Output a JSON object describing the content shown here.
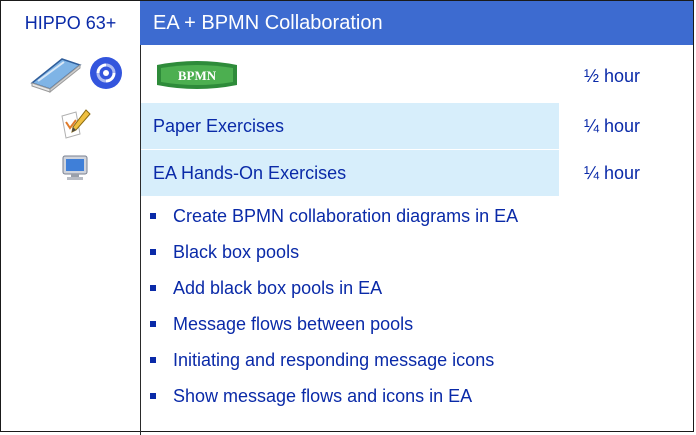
{
  "header": {
    "course_code": "HIPPO 63+",
    "title": "EA + BPMN Collaboration"
  },
  "schedule": [
    {
      "icons": [
        "book-icon",
        "cycle-icon"
      ],
      "label": "",
      "logo": "BPMN",
      "duration": "½ hour"
    },
    {
      "icons": [
        "pencil-paper-icon"
      ],
      "label": "Paper Exercises",
      "duration": "¼ hour"
    },
    {
      "icons": [
        "computer-monitor-icon"
      ],
      "label": "EA Hands-On Exercises",
      "duration": "¼ hour"
    }
  ],
  "topics": [
    "Create BPMN collaboration diagrams in EA",
    "Black box pools",
    "Add black box pools in EA",
    "Message flows between pools",
    "Initiating and responding message icons",
    "Show message flows and icons in EA"
  ],
  "colors": {
    "title_bar": "#3d6bd0",
    "row_shading": "#d7eefb",
    "text": "#0a2aa8"
  }
}
